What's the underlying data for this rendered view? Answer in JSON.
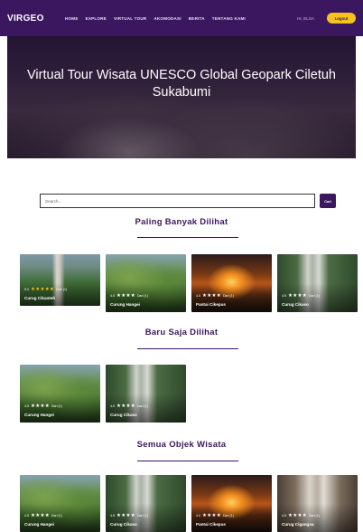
{
  "nav": {
    "brand": "VIRGEO",
    "links": [
      "HOME",
      "EXPLORE",
      "VIRTUAL TOUR",
      "AKOMODASI",
      "BERITA",
      "TENTANG KAMI"
    ],
    "user": "HI, ELSA",
    "button": "Logout"
  },
  "hero": {
    "title": "Virtual Tour Wisata UNESCO Global Geopark Ciletuh Sukabumi"
  },
  "search": {
    "placeholder": "Search...",
    "button": "Cari"
  },
  "sections": {
    "popular": "Paling Banyak Dilihat",
    "recent": "Baru Saja Dilihat",
    "all": "Semua Objek Wisata"
  },
  "cards": {
    "popular": [
      {
        "name": "Curug Cikanteh",
        "rating_label": "5.0",
        "stars": "★★★★★",
        "reviews": "Dari (1)"
      },
      {
        "name": "Curung Hangei",
        "rating_label": "4.5",
        "stars": "★★★★",
        "reviews": "Dari (1)"
      },
      {
        "name": "Pantai Cikepus",
        "rating_label": "4.0",
        "stars": "★★★★",
        "reviews": "Dari (1)"
      },
      {
        "name": "Curug Cikaso",
        "rating_label": "4.5",
        "stars": "★★★★",
        "reviews": "Dari (1)"
      }
    ],
    "recent": [
      {
        "name": "Curung Hangei",
        "rating_label": "4.5",
        "stars": "★★★★",
        "reviews": "Dari (1)"
      },
      {
        "name": "Curug Cikaso",
        "rating_label": "4.5",
        "stars": "★★★★",
        "reviews": "Dari (1)"
      }
    ],
    "all": [
      {
        "name": "Curung Hangei",
        "rating_label": "4.5",
        "stars": "★★★★",
        "reviews": "Dari (1)"
      },
      {
        "name": "Curug Cikaso",
        "rating_label": "4.5",
        "stars": "★★★★",
        "reviews": "Dari (1)"
      },
      {
        "name": "Pantai Cikepus",
        "rating_label": "4.0",
        "stars": "★★★★",
        "reviews": "Dari (1)"
      },
      {
        "name": "Curug Cigangsa",
        "rating_label": "4.5",
        "stars": "★★★★",
        "reviews": "Dari (1)"
      }
    ]
  },
  "colors": {
    "brand_purple": "#3b1760",
    "accent_yellow": "#f6c21c"
  }
}
